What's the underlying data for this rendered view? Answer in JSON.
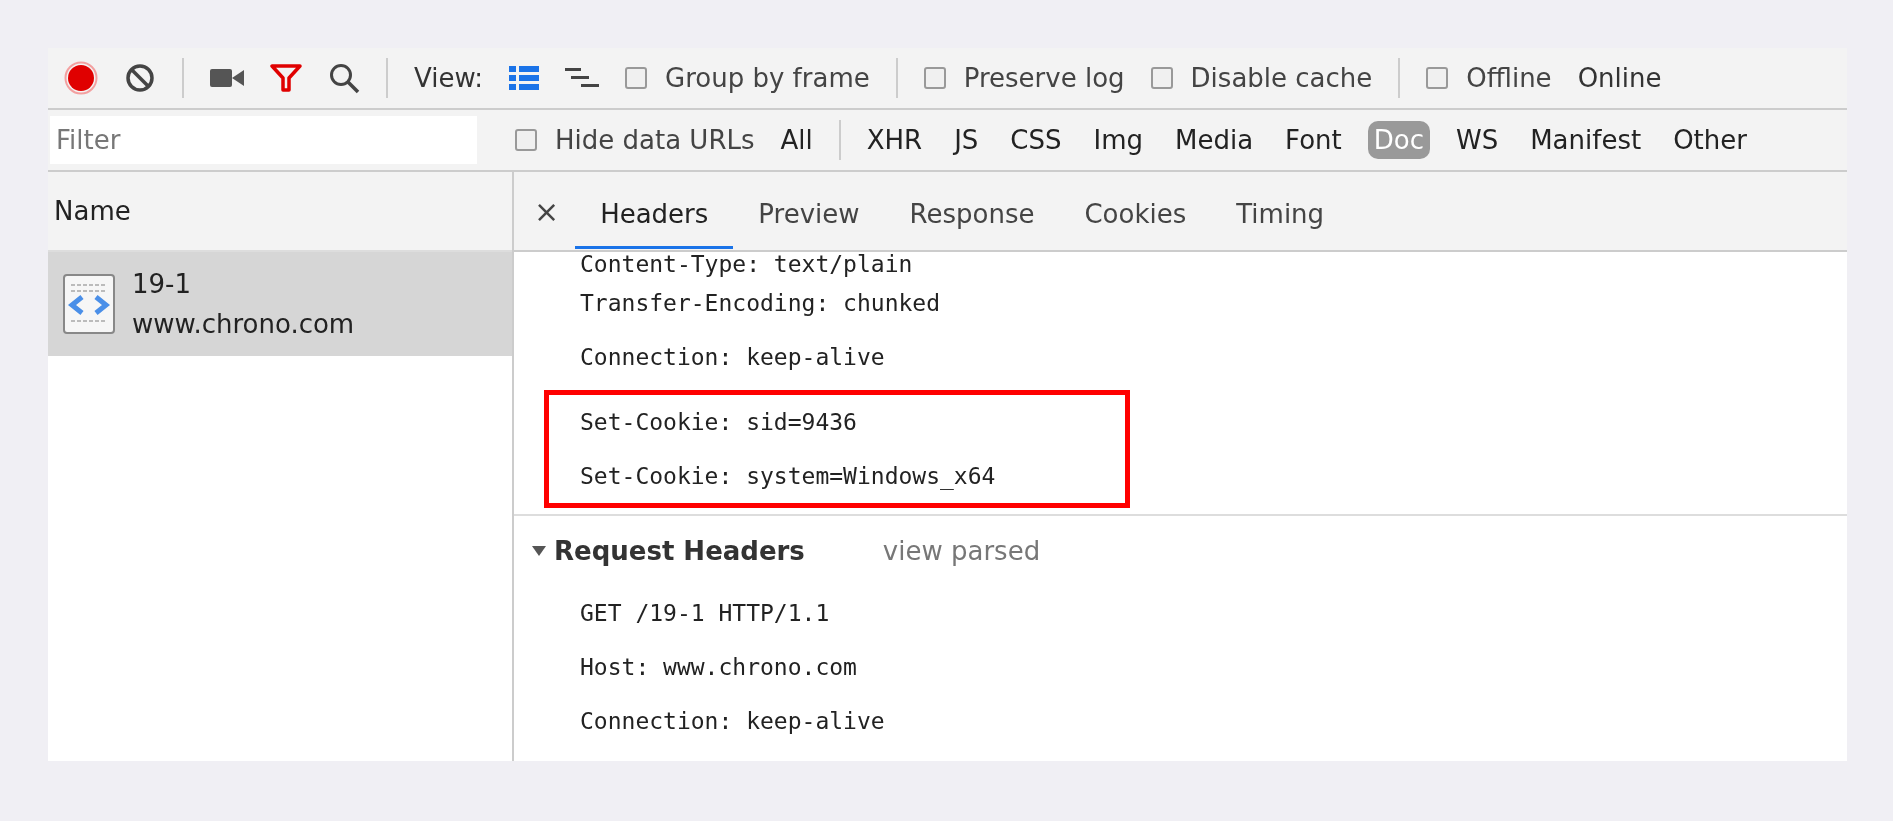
{
  "toolbar": {
    "recording": true,
    "view_label": "View:",
    "view_modes": [
      {
        "kind": "list",
        "selected": true
      },
      {
        "kind": "waterfall",
        "selected": false
      }
    ],
    "options": [
      {
        "label": "Group by frame",
        "checked": false
      },
      {
        "label": "Preserve log",
        "checked": false
      },
      {
        "label": "Disable cache",
        "checked": false
      },
      {
        "label": "Offline",
        "checked": false
      }
    ],
    "throttling": "Online"
  },
  "filter_bar": {
    "placeholder": "Filter",
    "hide_data_urls": {
      "label": "Hide data URLs",
      "checked": false
    },
    "types": [
      {
        "label": "All",
        "selected": false
      },
      {
        "label": "XHR",
        "selected": false
      },
      {
        "label": "JS",
        "selected": false
      },
      {
        "label": "CSS",
        "selected": false
      },
      {
        "label": "Img",
        "selected": false
      },
      {
        "label": "Media",
        "selected": false
      },
      {
        "label": "Font",
        "selected": false
      },
      {
        "label": "Doc",
        "selected": true
      },
      {
        "label": "WS",
        "selected": false
      },
      {
        "label": "Manifest",
        "selected": false
      },
      {
        "label": "Other",
        "selected": false
      }
    ]
  },
  "requests": {
    "column": "Name",
    "rows": [
      {
        "name": "19-1",
        "domain": "www.chrono.com",
        "selected": true
      }
    ]
  },
  "details": {
    "close": "×",
    "tabs": [
      {
        "label": "Headers",
        "selected": true
      },
      {
        "label": "Preview",
        "selected": false
      },
      {
        "label": "Response",
        "selected": false
      },
      {
        "label": "Cookies",
        "selected": false
      },
      {
        "label": "Timing",
        "selected": false
      }
    ],
    "response_headers": [
      {
        "text": "Content-Type: text/plain",
        "highlighted": false
      },
      {
        "text": "Transfer-Encoding: chunked",
        "highlighted": false
      },
      {
        "text": "Connection: keep-alive",
        "highlighted": false
      },
      {
        "text": "Set-Cookie: sid=9436",
        "highlighted": true
      },
      {
        "text": "Set-Cookie: system=Windows_x64",
        "highlighted": true
      }
    ],
    "request_headers": {
      "title": "Request Headers",
      "expanded": true,
      "link": "view parsed",
      "lines": [
        "GET /19-1 HTTP/1.1",
        "Host: www.chrono.com",
        "Connection: keep-alive"
      ]
    }
  }
}
